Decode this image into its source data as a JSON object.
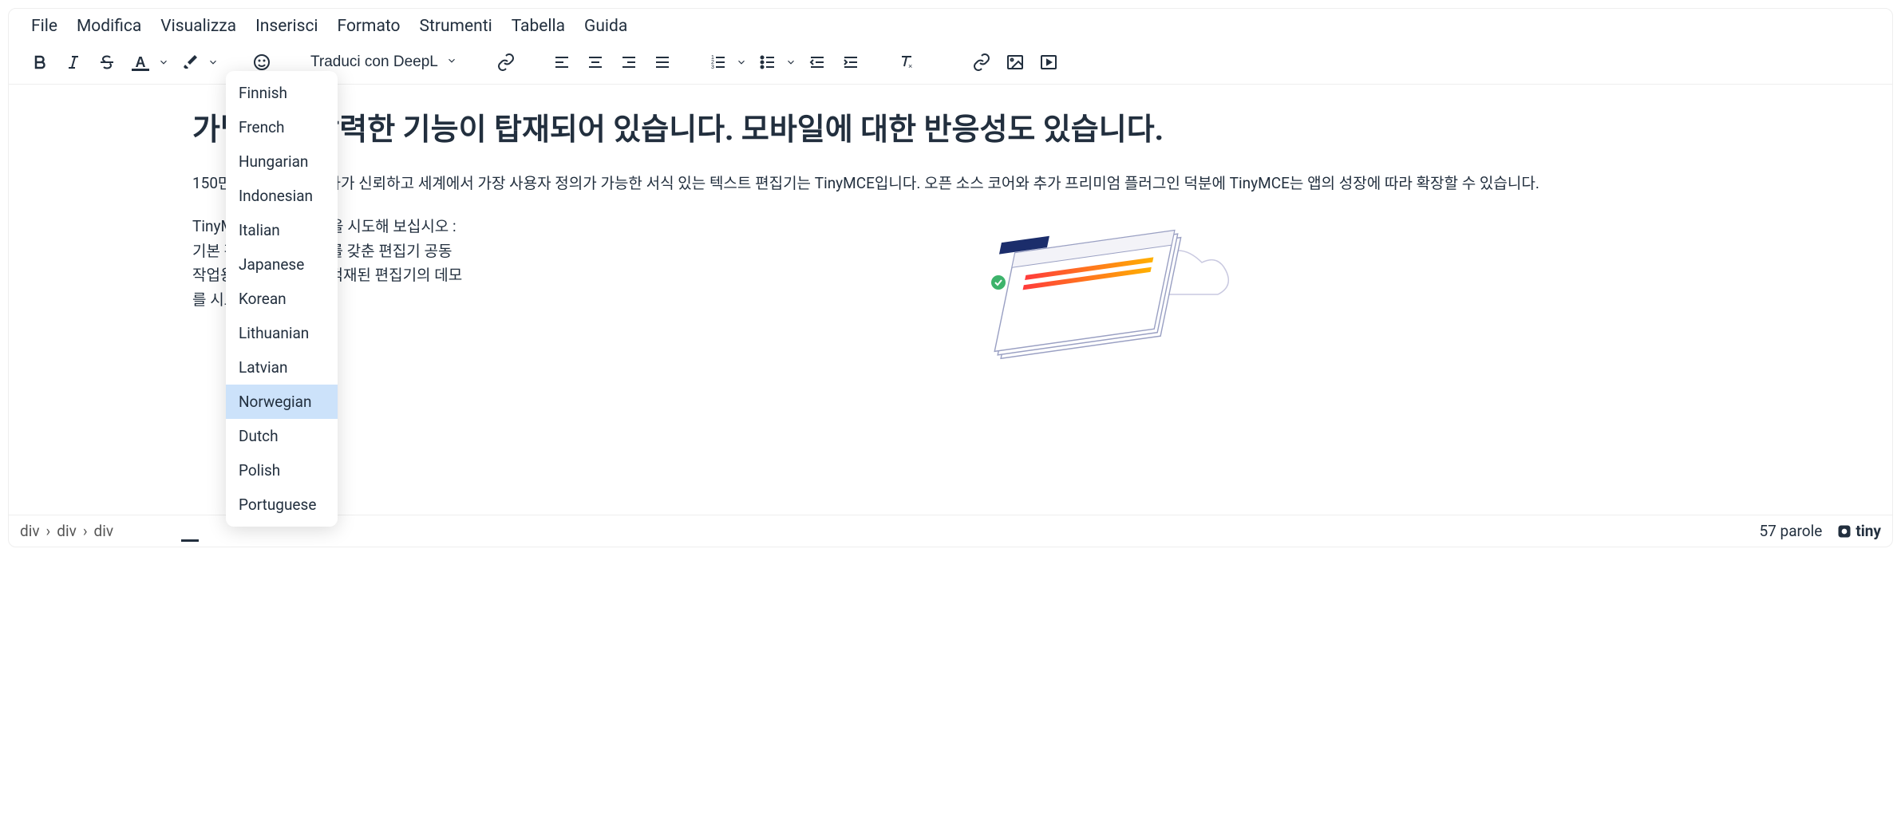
{
  "menu": {
    "file": "File",
    "edit": "Modifica",
    "view": "Visualizza",
    "insert": "Inserisci",
    "format": "Formato",
    "tools": "Strumenti",
    "table": "Tabella",
    "help": "Guida"
  },
  "toolbar": {
    "translate_label": "Traduci con DeepL"
  },
  "dropdown": {
    "items": [
      {
        "label": "Finnish"
      },
      {
        "label": "French"
      },
      {
        "label": "Hungarian"
      },
      {
        "label": "Indonesian"
      },
      {
        "label": "Italian"
      },
      {
        "label": "Japanese"
      },
      {
        "label": "Korean"
      },
      {
        "label": "Lithuanian"
      },
      {
        "label": "Latvian"
      },
      {
        "label": "Norwegian"
      },
      {
        "label": "Dutch"
      },
      {
        "label": "Polish"
      },
      {
        "label": "Portuguese"
      }
    ],
    "highlight_index": 9
  },
  "content": {
    "heading": "가볍지만 강력한 기능이 탑재되어 있습니다. 모바일에 대한 반응성도 있습니다.",
    "para1": "150만 명 이상의 개발자가 신뢰하고 세계에서 가장 사용자 정의가 가능한 서식 있는 텍스트 편집기는 TinyMCE입니다. 오픈 소스 코어와 추가 프리미엄 플러그인 덕분에 TinyMCE는 앱의 성장에 따라 확장할 수 있습니다.",
    "para2": "TinyMCE의 다음 설정을 시도해 보십시오 : 기본 편집기 고급 세트를 갖춘 편집기 공동 작업용 편집기 완전히 적재된 편집기의 데모를 시도해 보십시오."
  },
  "statusbar": {
    "path": [
      "div",
      "div",
      "div"
    ],
    "wordcount": "57 parole",
    "brand": "tiny"
  }
}
